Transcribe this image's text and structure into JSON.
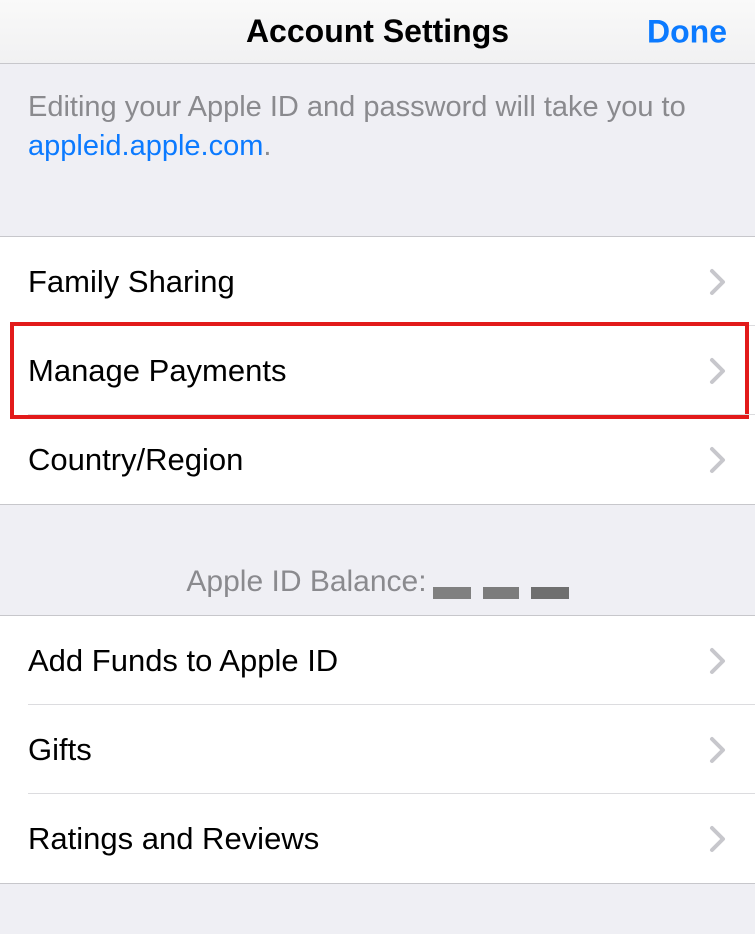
{
  "header": {
    "title": "Account Settings",
    "done": "Done"
  },
  "info": {
    "text_before_link": "Editing your Apple ID and password will take you to ",
    "link_text": "appleid.apple.com",
    "text_after_link": "."
  },
  "section1": {
    "items": [
      {
        "label": "Family Sharing"
      },
      {
        "label": "Manage Payments"
      },
      {
        "label": "Country/Region"
      }
    ]
  },
  "balance": {
    "label": "Apple ID Balance:"
  },
  "section2": {
    "items": [
      {
        "label": "Add Funds to Apple ID"
      },
      {
        "label": "Gifts"
      },
      {
        "label": "Ratings and Reviews"
      }
    ]
  }
}
